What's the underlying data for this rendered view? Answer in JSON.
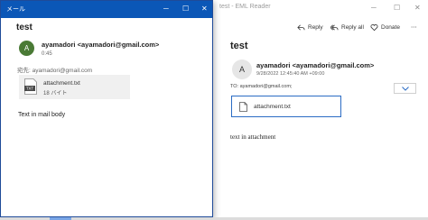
{
  "eml_window": {
    "title": "test - EML Reader",
    "controls": {
      "minimize": "─",
      "maximize": "☐",
      "close": "✕"
    },
    "toolbar": {
      "reply": "Reply",
      "reply_all": "Reply all",
      "donate": "Donate",
      "more": "⋯"
    },
    "subject": "test",
    "avatar_initial": "A",
    "sender": "ayamadori <ayamadori@gmail.com>",
    "date": "9/28/2022 12:45:40 AM +09:00",
    "to": "TO: ayamadori@gmail.com;",
    "attachment_name": "attachment.txt",
    "body": "text in attachment"
  },
  "mail_window": {
    "title": "メール",
    "controls": {
      "minimize": "─",
      "maximize": "☐",
      "close": "✕"
    },
    "subject": "test",
    "avatar_initial": "A",
    "avatar_color": "#4a7a35",
    "sender": "ayamadori <ayamadori@gmail.com>",
    "time": "0:45",
    "to": "宛先: ayamadori@gmail.com",
    "attachment": {
      "icon_label": "TXT",
      "name": "attachment.txt",
      "size": "18 バイト"
    },
    "body": "Text in mail body"
  },
  "colors": {
    "accent": "#0b57b7",
    "attachment_border": "#2b6cc4"
  }
}
